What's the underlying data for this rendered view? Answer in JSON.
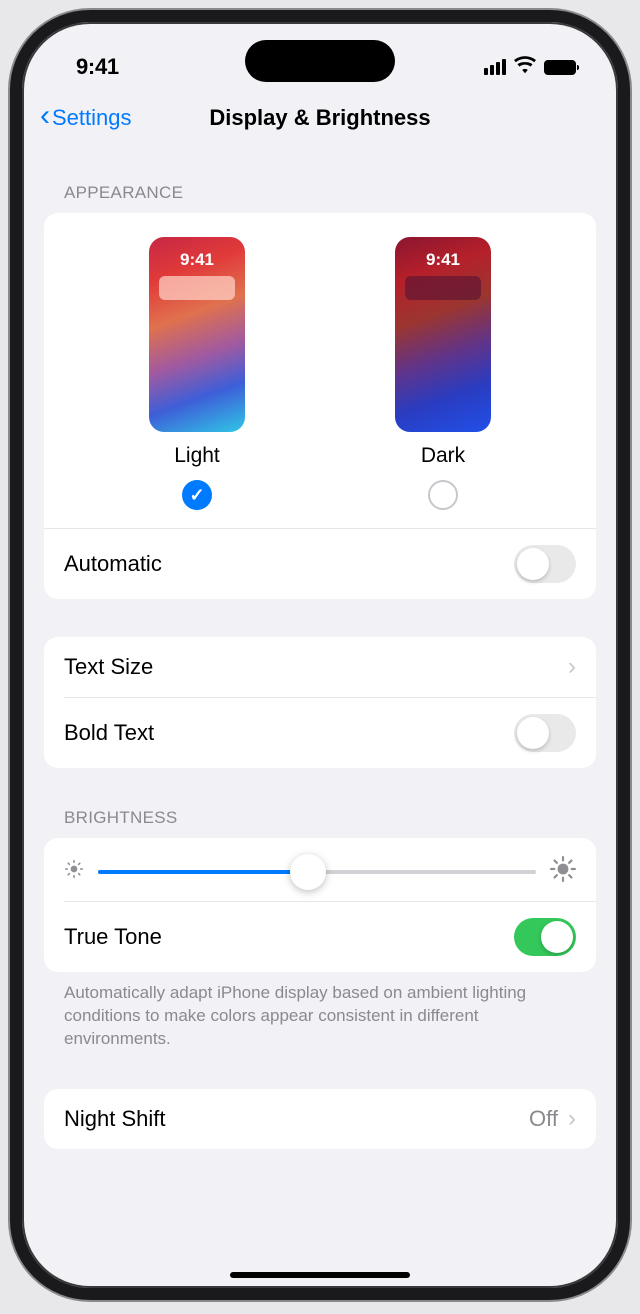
{
  "status": {
    "time": "9:41"
  },
  "nav": {
    "back_label": "Settings",
    "title": "Display & Brightness"
  },
  "appearance": {
    "header": "Appearance",
    "options": [
      {
        "label": "Light",
        "preview_time": "9:41",
        "selected": true
      },
      {
        "label": "Dark",
        "preview_time": "9:41",
        "selected": false
      }
    ],
    "automatic": {
      "label": "Automatic",
      "on": false
    }
  },
  "text": {
    "text_size_label": "Text Size",
    "bold_text": {
      "label": "Bold Text",
      "on": false
    }
  },
  "brightness": {
    "header": "Brightness",
    "slider_value": 0.48,
    "true_tone": {
      "label": "True Tone",
      "on": true
    },
    "footer": "Automatically adapt iPhone display based on ambient lighting conditions to make colors appear consistent in different environments."
  },
  "night_shift": {
    "label": "Night Shift",
    "value": "Off"
  }
}
